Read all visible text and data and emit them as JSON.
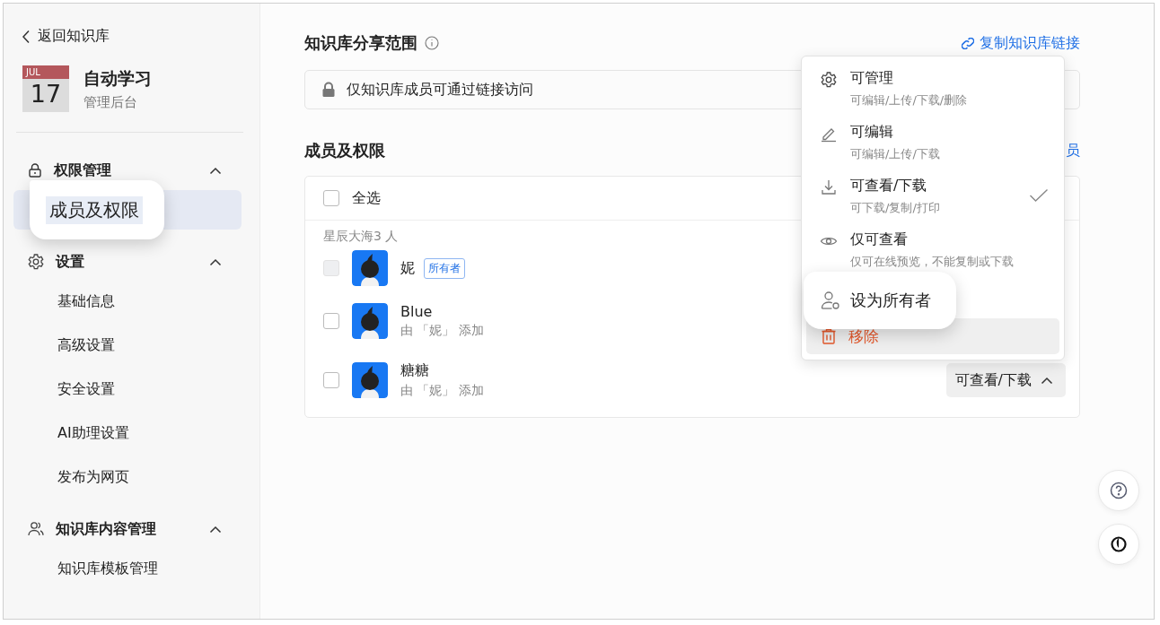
{
  "sidebar": {
    "back": "返回知识库",
    "calendar": {
      "month": "JUL",
      "day": "17"
    },
    "title": "自动学习",
    "subtitle": "管理后台",
    "groups": [
      {
        "label": "权限管理",
        "expanded": true,
        "items": [
          {
            "label": "成员及权限",
            "selected": true
          }
        ]
      },
      {
        "label": "设置",
        "expanded": true,
        "items": [
          {
            "label": "基础信息",
            "selected": false
          },
          {
            "label": "高级设置",
            "selected": false
          },
          {
            "label": "安全设置",
            "selected": false
          },
          {
            "label": "AI助理设置",
            "selected": false
          },
          {
            "label": "发布为网页",
            "selected": false
          }
        ]
      },
      {
        "label": "知识库内容管理",
        "expanded": true,
        "items": [
          {
            "label": "知识库模板管理",
            "selected": false
          }
        ]
      }
    ]
  },
  "share": {
    "title": "知识库分享范围",
    "copy_link": "复制知识库链接",
    "scope": "仅知识库成员可通过链接访问"
  },
  "members": {
    "title": "成员及权限",
    "add_link": "员",
    "select_all": {
      "label": "全选",
      "checked": false
    },
    "group_label": "星辰大海3 人",
    "rows": [
      {
        "name": "妮",
        "badge": "所有者",
        "checked": false,
        "disabled": true
      },
      {
        "name": "Blue",
        "note": "由 「妮」 添加",
        "checked": false,
        "disabled": false
      },
      {
        "name": "糖糖",
        "note": "由 「妮」 添加",
        "checked": false,
        "disabled": false,
        "permission": "可查看/下载"
      }
    ]
  },
  "menu": {
    "items": [
      {
        "kind": "option",
        "label": "可管理",
        "desc": "可编辑/上传/下载/删除",
        "selected": false
      },
      {
        "kind": "option",
        "label": "可编辑",
        "desc": "可编辑/上传/下载",
        "selected": false
      },
      {
        "kind": "option",
        "label": "可查看/下载",
        "desc": "可下载/复制/打印",
        "selected": true
      },
      {
        "kind": "option",
        "label": "仅可查看",
        "desc": "仅可在线预览，不能复制或下载",
        "selected": false
      },
      {
        "kind": "magnified",
        "label": "设为所有者"
      },
      {
        "kind": "danger",
        "label": "移除",
        "hovered": true
      }
    ]
  }
}
